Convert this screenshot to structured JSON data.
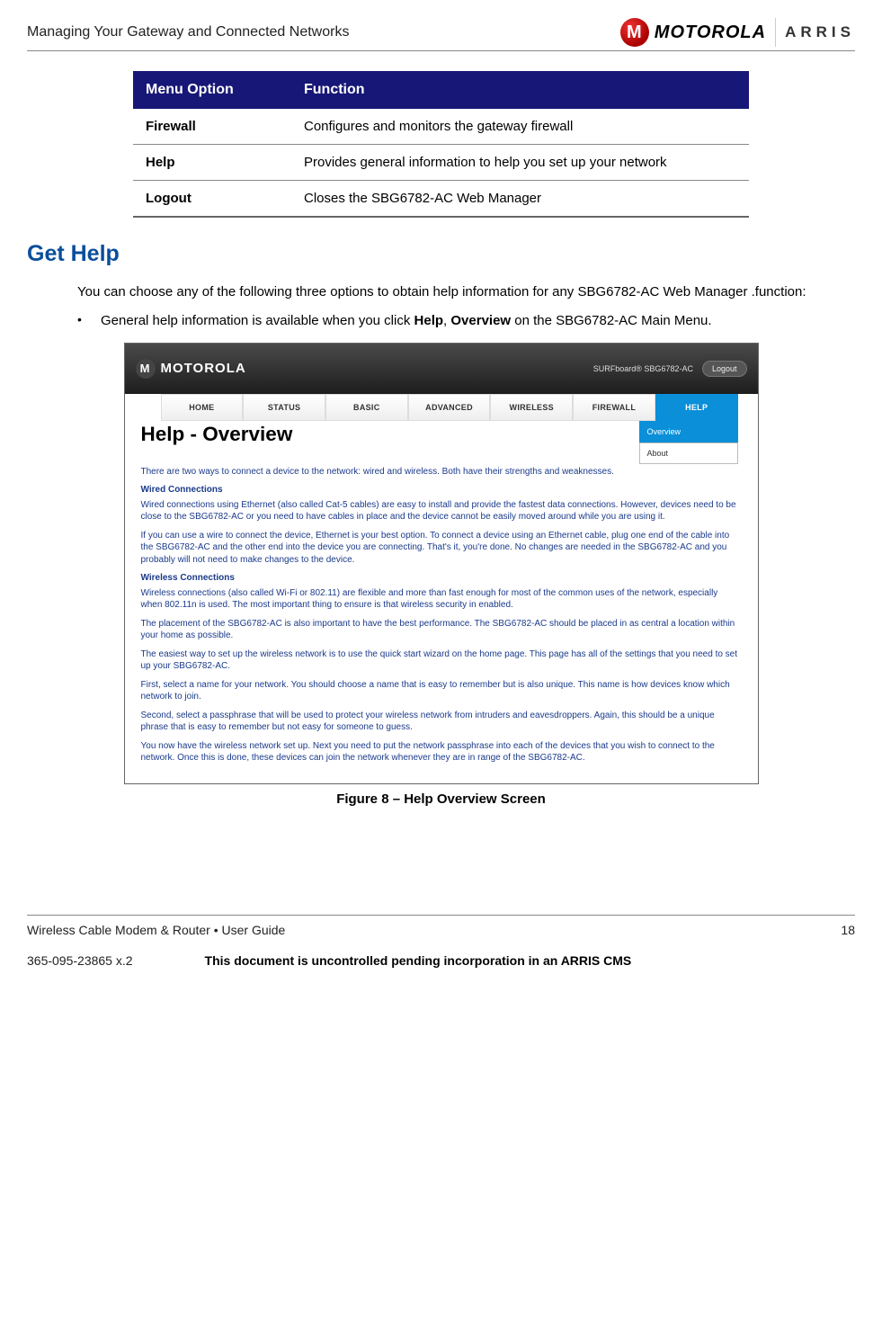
{
  "header": {
    "title": "Managing Your Gateway and Connected Networks",
    "logo_moto": "MOTOROLA",
    "logo_arris": "ARRIS"
  },
  "table": {
    "col_menu": "Menu Option",
    "col_func": "Function",
    "rows": [
      {
        "opt": "Firewall",
        "func": "Configures and monitors the gateway firewall"
      },
      {
        "opt": "Help",
        "func": "Provides general information to help you set up your network"
      },
      {
        "opt": "Logout",
        "func": "Closes the SBG6782-AC Web Manager"
      }
    ]
  },
  "section": {
    "heading": "Get Help",
    "intro": "You can choose any of the following three options to obtain help information for any SBG6782-AC Web Manager .function:",
    "bullet_pre": "General help information is available when you click ",
    "bullet_b1": "Help",
    "bullet_sep": ", ",
    "bullet_b2": "Overview",
    "bullet_post": " on the SBG6782-AC Main Menu."
  },
  "screenshot": {
    "top_brand": "MOTOROLA",
    "top_product": "SURFboard® SBG6782-AC",
    "logout": "Logout",
    "nav": [
      "HOME",
      "STATUS",
      "BASIC",
      "ADVANCED",
      "WIRELESS",
      "FIREWALL",
      "HELP"
    ],
    "sub": [
      "Overview",
      "About"
    ],
    "page_h": "Help - Overview",
    "p_intro": "There are two ways to connect a device to the network: wired and wireless. Both have their strengths and weaknesses.",
    "h_wired": "Wired Connections",
    "p_w1": "Wired connections using Ethernet (also called Cat-5 cables) are easy to install and provide the fastest data connections. However, devices need to be close to the SBG6782-AC or you need to have cables in place and the device cannot be easily moved around while you are using it.",
    "p_w2": "If you can use a wire to connect the device, Ethernet is your best option. To connect a device using an Ethernet cable, plug one end of the cable into the SBG6782-AC and the other end into the device you are connecting. That's it, you're done. No changes are needed in the SBG6782-AC and you probably will not need to make changes to the device.",
    "h_wireless": "Wireless Connections",
    "p_wl1": "Wireless connections (also called Wi-Fi or 802.11) are flexible and more than fast enough for most of the common uses of the network, especially when 802.11n is used. The most important thing to ensure is that wireless security in enabled.",
    "p_wl2": "The placement of the SBG6782-AC is also important to have the best performance. The SBG6782-AC should be placed in as central a location within your home as possible.",
    "p_wl3": "The easiest way to set up the wireless network is to use the quick start wizard on the home page. This page has all of the settings that you need to set up your SBG6782-AC.",
    "p_wl4": "First, select a name for your network. You should choose a name that is easy to remember but is also unique. This name is how devices know which network to join.",
    "p_wl5": "Second, select a passphrase that will be used to protect your wireless network from intruders and eavesdroppers. Again, this should be a unique phrase that is easy to remember but not easy for someone to guess.",
    "p_wl6": "You now have the wireless network set up. Next you need to put the network passphrase into each of the devices that you wish to connect to the network. Once this is done, these devices can join the network whenever they are in range of the SBG6782-AC."
  },
  "caption": "Figure 8 – Help Overview Screen",
  "footer": {
    "left": "Wireless Cable Modem & Router • User Guide",
    "page": "18",
    "docnum": "365-095-23865 x.2",
    "uncontrolled": "This document is uncontrolled pending incorporation in an ARRIS CMS"
  }
}
